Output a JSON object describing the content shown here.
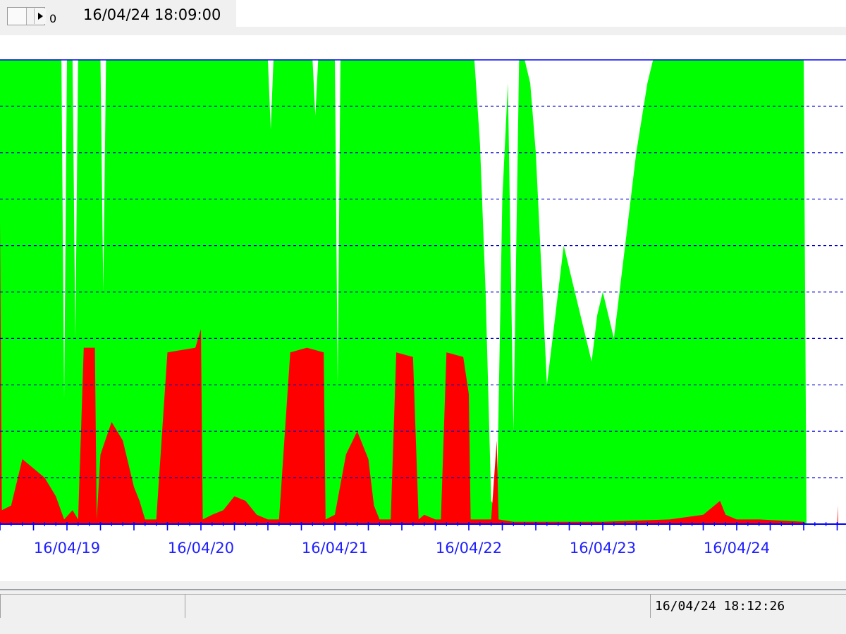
{
  "toolbar": {
    "scroll_value": "0",
    "timestamp": "16/04/24 18:09:00"
  },
  "status_bar": {
    "timestamp": "16/04/24 18:12:26"
  },
  "colors": {
    "series_green": "#00ff00",
    "series_red": "#ff0000",
    "axis": "#0000ff",
    "grid": "#0000cc",
    "tick_label": "#2020ff"
  },
  "chart_data": {
    "type": "area",
    "grid": "horizontal dashed",
    "x_tick_labels": [
      "16/04/19",
      "16/04/20",
      "16/04/21",
      "16/04/22",
      "16/04/23",
      "16/04/24"
    ],
    "x_range": [
      "16/04/18 12:00",
      "16/04/24 18:00"
    ],
    "ylim": [
      0,
      100
    ],
    "gridlines": [
      10,
      20,
      30,
      40,
      50,
      60,
      70,
      80,
      90
    ],
    "series": [
      {
        "color": "#00ff00",
        "points": [
          [
            "16/04/18 12:00",
            100
          ],
          [
            "16/04/18 23:00",
            100
          ],
          [
            "16/04/18 23:30",
            27
          ],
          [
            "16/04/19 00:00",
            100
          ],
          [
            "16/04/19 01:00",
            100
          ],
          [
            "16/04/19 01:30",
            40
          ],
          [
            "16/04/19 02:00",
            100
          ],
          [
            "16/04/19 06:00",
            100
          ],
          [
            "16/04/19 06:30",
            50
          ],
          [
            "16/04/19 07:00",
            100
          ],
          [
            "16/04/20 12:00",
            100
          ],
          [
            "16/04/20 12:30",
            85
          ],
          [
            "16/04/20 13:00",
            100
          ],
          [
            "16/04/20 20:00",
            100
          ],
          [
            "16/04/20 20:30",
            88
          ],
          [
            "16/04/20 21:00",
            100
          ],
          [
            "16/04/21 00:00",
            100
          ],
          [
            "16/04/21 00:30",
            30
          ],
          [
            "16/04/21 01:00",
            100
          ],
          [
            "16/04/22 00:00",
            100
          ],
          [
            "16/04/22 01:00",
            100
          ],
          [
            "16/04/22 02:00",
            82
          ],
          [
            "16/04/22 03:00",
            50
          ],
          [
            "16/04/22 04:00",
            5
          ],
          [
            "16/04/22 05:00",
            3
          ],
          [
            "16/04/22 06:00",
            70
          ],
          [
            "16/04/22 07:00",
            95
          ],
          [
            "16/04/22 08:00",
            20
          ],
          [
            "16/04/22 09:00",
            100
          ],
          [
            "16/04/22 10:00",
            100
          ],
          [
            "16/04/22 11:00",
            95
          ],
          [
            "16/04/22 12:00",
            80
          ],
          [
            "16/04/22 14:00",
            30
          ],
          [
            "16/04/22 15:00",
            40
          ],
          [
            "16/04/22 17:00",
            60
          ],
          [
            "16/04/22 19:00",
            50
          ],
          [
            "16/04/22 21:00",
            40
          ],
          [
            "16/04/22 22:00",
            35
          ],
          [
            "16/04/22 23:00",
            45
          ],
          [
            "16/04/23 00:00",
            50
          ],
          [
            "16/04/23 02:00",
            40
          ],
          [
            "16/04/23 04:00",
            60
          ],
          [
            "16/04/23 06:00",
            80
          ],
          [
            "16/04/23 08:00",
            95
          ],
          [
            "16/04/23 09:00",
            100
          ],
          [
            "16/04/24 12:00",
            100
          ],
          [
            "16/04/24 12:30",
            0
          ],
          [
            "16/04/24 18:00",
            0
          ]
        ]
      },
      {
        "color": "#ff0000",
        "points": [
          [
            "16/04/18 12:00",
            65
          ],
          [
            "16/04/18 12:20",
            3
          ],
          [
            "16/04/18 14:00",
            4
          ],
          [
            "16/04/18 16:00",
            14
          ],
          [
            "16/04/18 18:00",
            12
          ],
          [
            "16/04/18 20:00",
            10
          ],
          [
            "16/04/18 22:00",
            6
          ],
          [
            "16/04/18 23:30",
            1
          ],
          [
            "16/04/19 01:00",
            3
          ],
          [
            "16/04/19 02:00",
            1
          ],
          [
            "16/04/19 03:00",
            38
          ],
          [
            "16/04/19 05:00",
            38
          ],
          [
            "16/04/19 05:20",
            1
          ],
          [
            "16/04/19 06:00",
            15
          ],
          [
            "16/04/19 08:00",
            22
          ],
          [
            "16/04/19 10:00",
            18
          ],
          [
            "16/04/19 12:00",
            8
          ],
          [
            "16/04/19 13:00",
            5
          ],
          [
            "16/04/19 14:00",
            1
          ],
          [
            "16/04/19 16:00",
            1
          ],
          [
            "16/04/19 18:00",
            37
          ],
          [
            "16/04/19 23:00",
            38
          ],
          [
            "16/04/20 00:00",
            42
          ],
          [
            "16/04/20 00:20",
            1
          ],
          [
            "16/04/20 02:00",
            2
          ],
          [
            "16/04/20 04:00",
            3
          ],
          [
            "16/04/20 06:00",
            6
          ],
          [
            "16/04/20 08:00",
            5
          ],
          [
            "16/04/20 10:00",
            2
          ],
          [
            "16/04/20 12:00",
            1
          ],
          [
            "16/04/20 14:00",
            1
          ],
          [
            "16/04/20 16:00",
            37
          ],
          [
            "16/04/20 19:00",
            38
          ],
          [
            "16/04/20 22:00",
            37
          ],
          [
            "16/04/20 22:20",
            1
          ],
          [
            "16/04/21 00:00",
            2
          ],
          [
            "16/04/21 02:00",
            15
          ],
          [
            "16/04/21 04:00",
            20
          ],
          [
            "16/04/21 06:00",
            14
          ],
          [
            "16/04/21 07:00",
            4
          ],
          [
            "16/04/21 08:00",
            1
          ],
          [
            "16/04/21 10:00",
            1
          ],
          [
            "16/04/21 11:00",
            37
          ],
          [
            "16/04/21 14:00",
            36
          ],
          [
            "16/04/21 15:00",
            1
          ],
          [
            "16/04/21 16:00",
            2
          ],
          [
            "16/04/21 18:00",
            1
          ],
          [
            "16/04/21 19:00",
            1
          ],
          [
            "16/04/21 20:00",
            37
          ],
          [
            "16/04/21 23:00",
            36
          ],
          [
            "16/04/22 00:00",
            28
          ],
          [
            "16/04/22 00:20",
            1
          ],
          [
            "16/04/22 02:00",
            1
          ],
          [
            "16/04/22 04:00",
            1
          ],
          [
            "16/04/22 05:00",
            18
          ],
          [
            "16/04/22 05:20",
            1
          ],
          [
            "16/04/22 08:00",
            0.5
          ],
          [
            "16/04/23 00:00",
            0.5
          ],
          [
            "16/04/23 12:00",
            1
          ],
          [
            "16/04/23 18:00",
            2
          ],
          [
            "16/04/23 21:00",
            5
          ],
          [
            "16/04/23 22:00",
            2
          ],
          [
            "16/04/24 00:00",
            1
          ],
          [
            "16/04/24 04:00",
            1
          ],
          [
            "16/04/24 12:00",
            0.5
          ],
          [
            "16/04/24 12:30",
            0
          ],
          [
            "16/04/24 18:00",
            0
          ],
          [
            "16/04/24 18:10",
            4
          ]
        ]
      }
    ]
  }
}
